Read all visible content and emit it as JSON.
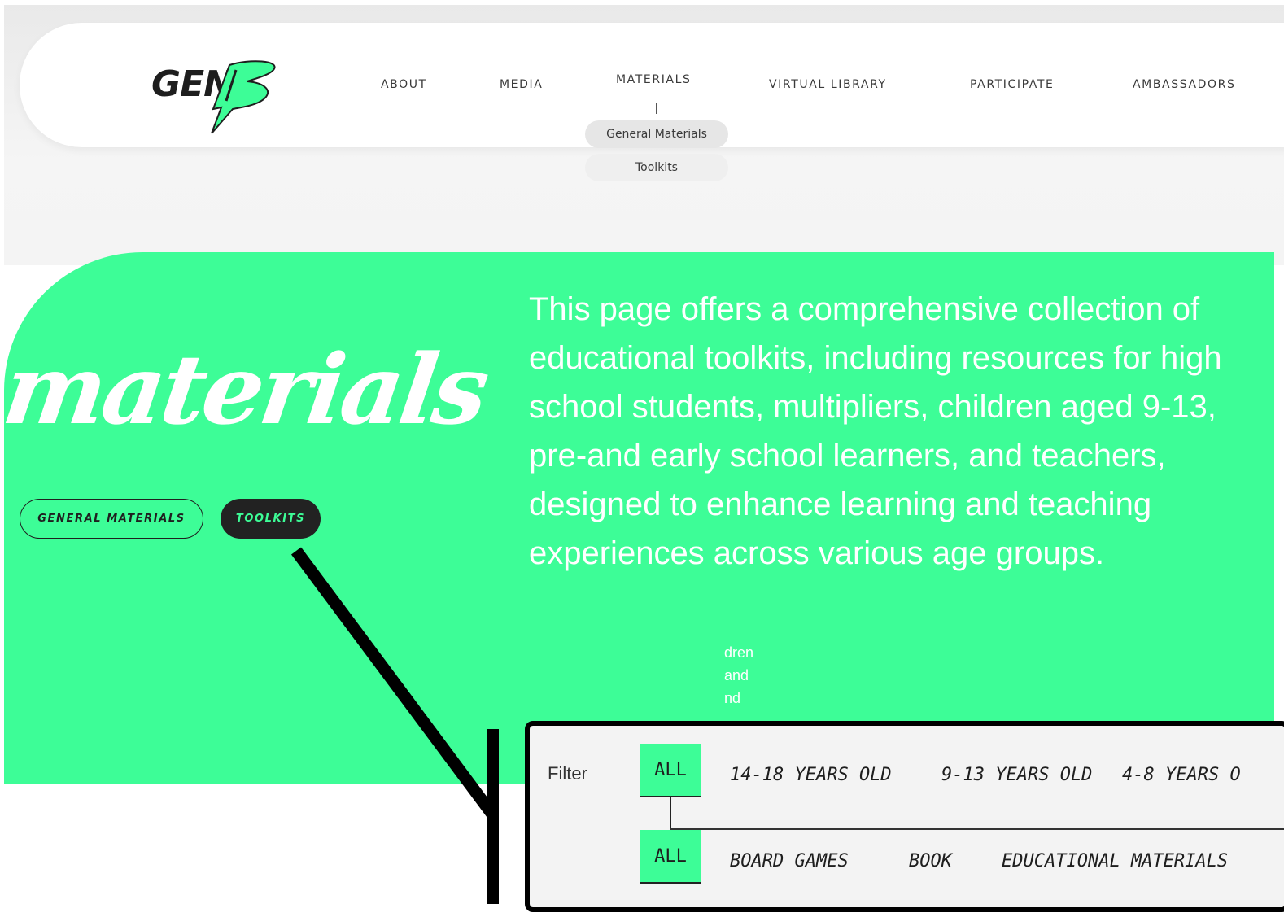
{
  "header": {
    "logo_text": "GEN",
    "nav": {
      "about": "ABOUT",
      "media": "MEDIA",
      "materials": "MATERIALS",
      "virtual_library": "VIRTUAL LIBRARY",
      "participate": "PARTICIPATE",
      "ambassadors": "AMBASSADORS"
    },
    "dropdown": {
      "general_materials": "General Materials",
      "toolkits": "Toolkits"
    }
  },
  "hero": {
    "title": "materials",
    "pill_general": "GENERAL MATERIALS",
    "pill_toolkits": "TOOLKITS",
    "description": "This page offers a comprehensive collection of educational toolkits, including resources for high school students, multipliers, children aged 9-13, pre-and early school learners, and teachers, designed to enhance learning and teaching experiences across various age groups.",
    "overflow_fragment": [
      "dren",
      "and",
      "nd"
    ]
  },
  "filter": {
    "label": "Filter",
    "age_active": "ALL",
    "age_options": [
      "14-18 YEARS OLD",
      "9-13 YEARS OLD",
      "4-8 YEARS O"
    ],
    "type_active": "ALL",
    "type_options": [
      "BOARD GAMES",
      "BOOK",
      "EDUCATIONAL MATERIALS"
    ]
  },
  "colors": {
    "brand_green": "#3dfd97",
    "dark": "#222222"
  }
}
